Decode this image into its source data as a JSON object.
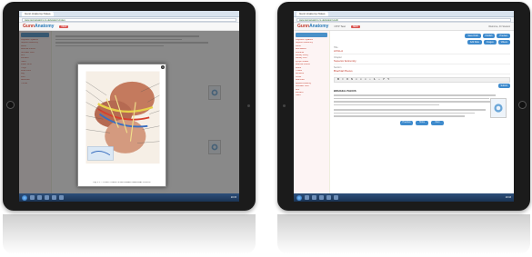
{
  "left_tablet": {
    "browser": {
      "tab_title": "Gunn Anatomy Notes",
      "url": "www.gunnanatomy.co.uk/anatomy/notes"
    },
    "app": {
      "logo_text": "Gunn",
      "logo_accent": "Anatomy",
      "header_badge": "NEW"
    },
    "sidebar_items": [
      "Objective Syllabus",
      "Superior Extremity",
      "Axilla",
      "Brachial Plexus",
      "Shoulder Joint",
      "Arm",
      "Forearm",
      "Hand",
      "Lower Limb",
      "Thigh",
      "Knee Joint",
      "Leg",
      "Foot",
      "Abdomen",
      "Thorax"
    ],
    "modal": {
      "close_label": "×",
      "caption": "Fig. 5.1 — STRUCTURES OF AXILLA AND BRACHIAL PLEXUS"
    },
    "taskbar_time": "10:15"
  },
  "right_tablet": {
    "browser": {
      "tab_title": "Gunn Anatomy Notes",
      "url": "www.gunnanatomy.co.uk/anatomy/edit"
    },
    "app": {
      "logo_text": "Gunn",
      "logo_accent": "Anatomy",
      "header_title": "OTP Test",
      "header_badge": "NEW",
      "header_right": "Welcome, Dr Student"
    },
    "sidebar_items": [
      "Objective Syllabus",
      "Superior Extremity",
      "Axilla",
      "Boundaries",
      "Contents",
      "Axillary Artery",
      "Axillary Vein",
      "Lymph Nodes",
      "Brachial Plexus",
      "Roots",
      "Trunks",
      "Divisions",
      "Cords",
      "Branches",
      "Applied Anatomy",
      "Shoulder Joint",
      "Arm",
      "Forearm",
      "Hand"
    ],
    "action_buttons": [
      "Save Draft",
      "Publish",
      "Preview"
    ],
    "secondary_buttons": [
      "Add Note",
      "Images",
      "Videos"
    ],
    "fields": [
      {
        "label": "Title",
        "value": "AXILLA"
      },
      {
        "label": "Chapter",
        "value": "Superior Extremity"
      },
      {
        "label": "Section",
        "value": "Brachial Plexus"
      }
    ],
    "editor_tools": [
      "B",
      "I",
      "U",
      "S",
      "≡",
      "≡",
      "≡",
      "•",
      "1.",
      "⌂",
      "↶",
      "↷"
    ],
    "editor_button": "Submit",
    "heading_label": "BRACHIAL PLEXUS",
    "nav_buttons": [
      "Previous",
      "Home",
      "Next"
    ],
    "taskbar_time": "10:16"
  },
  "colors": {
    "accent_blue": "#3f8bcd",
    "link_red": "#c0392b",
    "taskbar": "#1a3354"
  }
}
